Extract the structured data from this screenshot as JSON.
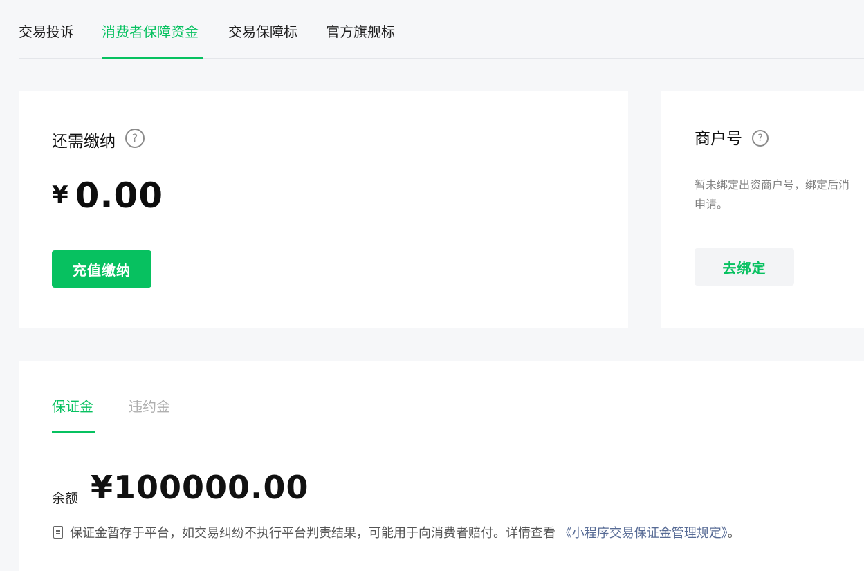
{
  "top_tabs": [
    {
      "label": "交易投诉"
    },
    {
      "label": "消费者保障资金"
    },
    {
      "label": "交易保障标"
    },
    {
      "label": "官方旗舰标"
    }
  ],
  "active_top_tab": "消费者保障资金",
  "payment_card": {
    "title": "还需缴纳",
    "help": "?",
    "currency": "¥",
    "amount": "0.00",
    "button_label": "充值缴纳"
  },
  "merchant_card": {
    "title": "商户号",
    "help": "?",
    "description_line1": "暂未绑定出资商户号，绑定后消",
    "description_line2": "申请。",
    "button_label": "去绑定"
  },
  "deposit_section": {
    "tabs": [
      {
        "label": "保证金"
      },
      {
        "label": "违约金"
      }
    ],
    "active_tab": "保证金",
    "balance_label": "余额",
    "balance_value": "¥100000.00",
    "note_text": "保证金暂存于平台，如交易纠纷不执行平台判责结果，可能用于向消费者赔付。详情查看",
    "note_link": "《小程序交易保证金管理规定》",
    "note_end": "。"
  },
  "colors": {
    "accent": "#07c160",
    "link": "#576b95",
    "background": "#f6f7f9"
  }
}
